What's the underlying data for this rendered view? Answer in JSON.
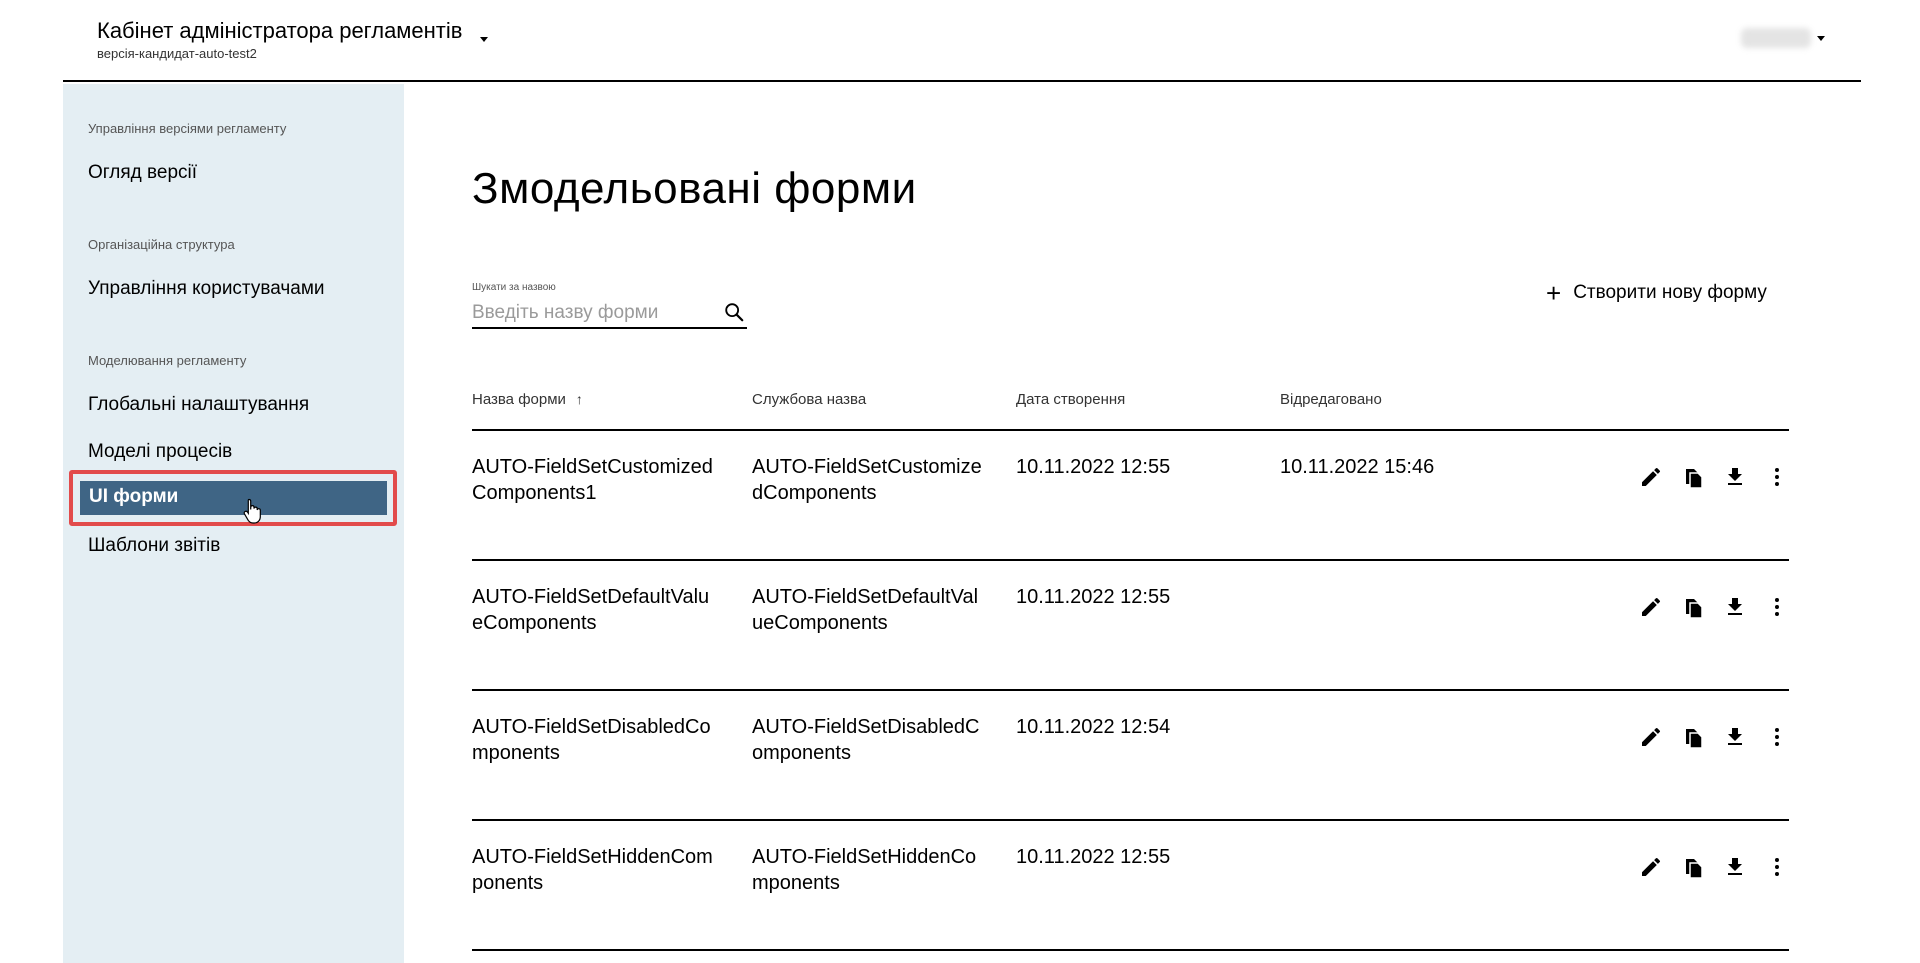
{
  "header": {
    "app_title": "Кабінет адміністратора регламентів",
    "app_subtitle": "версія-кандидат-auto-test2",
    "user_name": "admin"
  },
  "sidebar": {
    "sections": [
      {
        "title": "Управління версіями регламенту",
        "items": [
          "Огляд версії"
        ]
      },
      {
        "title": "Організаційна структура",
        "items": [
          "Управління користувачами"
        ]
      },
      {
        "title": "Моделювання регламенту",
        "items": [
          "Глобальні налаштування",
          "Моделі процесів",
          "UI форми",
          "Шаблони звітів"
        ]
      }
    ],
    "active_item": "UI форми"
  },
  "main": {
    "title": "Змодельовані форми",
    "search": {
      "label": "Шукати за назвою",
      "placeholder": "Введіть назву форми",
      "value": ""
    },
    "create_button": "Створити нову форму",
    "table": {
      "headers": [
        "Назва форми",
        "Службова назва",
        "Дата створення",
        "Відредаговано"
      ],
      "sort_column": "Назва форми",
      "sort_direction": "asc",
      "rows": [
        {
          "name": "AUTO-FieldSetCustomizedComponents1",
          "service_name": "AUTO-FieldSetCustomizedComponents",
          "created": "10.11.2022 12:55",
          "edited": "10.11.2022 15:46"
        },
        {
          "name": "AUTO-FieldSetDefaultValueComponents",
          "service_name": "AUTO-FieldSetDefaultValueComponents",
          "created": "10.11.2022 12:55",
          "edited": ""
        },
        {
          "name": "AUTO-FieldSetDisabledComponents",
          "service_name": "AUTO-FieldSetDisabledComponents",
          "created": "10.11.2022 12:54",
          "edited": ""
        },
        {
          "name": "AUTO-FieldSetHiddenComponents",
          "service_name": "AUTO-FieldSetHiddenComponents",
          "created": "10.11.2022 12:55",
          "edited": ""
        }
      ],
      "row_actions": [
        "pencil-icon",
        "copy-icon",
        "download-icon",
        "more-vert-icon"
      ]
    }
  },
  "colors": {
    "sidebar_bg": "#e4eef3",
    "active_item_bg": "#3f6585",
    "highlight_border": "#e24b4b"
  }
}
